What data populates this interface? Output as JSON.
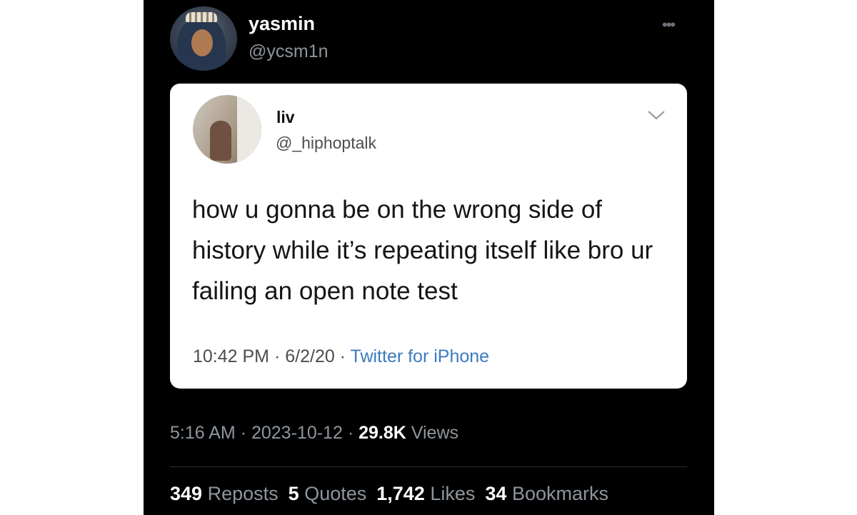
{
  "tweet": {
    "author_name": "yasmin",
    "author_handle": "@ycsm1n",
    "more_icon": "ellipsis-icon",
    "quoted": {
      "name": "liv",
      "handle": "@_hiphoptalk",
      "text": "how u gonna be on the wrong side of history while it’s repeating itself like bro ur failing an open note test",
      "time": "10:42 PM",
      "date": "6/2/20",
      "source": "Twitter for iPhone",
      "menu_icon": "chevron-down-icon"
    },
    "time": "5:16 AM",
    "date": "2023-10-12",
    "views_count": "29.8K",
    "views_label": "Views"
  },
  "stats": {
    "reposts_count": "349",
    "reposts_label": "Reposts",
    "quotes_count": "5",
    "quotes_label": "Quotes",
    "likes_count": "1,742",
    "likes_label": "Likes",
    "bookmarks_count": "34",
    "bookmarks_label": "Bookmarks"
  },
  "colors": {
    "background": "#000000",
    "card": "#ffffff",
    "muted_text": "#8e959c",
    "link": "#3b7ac0"
  }
}
